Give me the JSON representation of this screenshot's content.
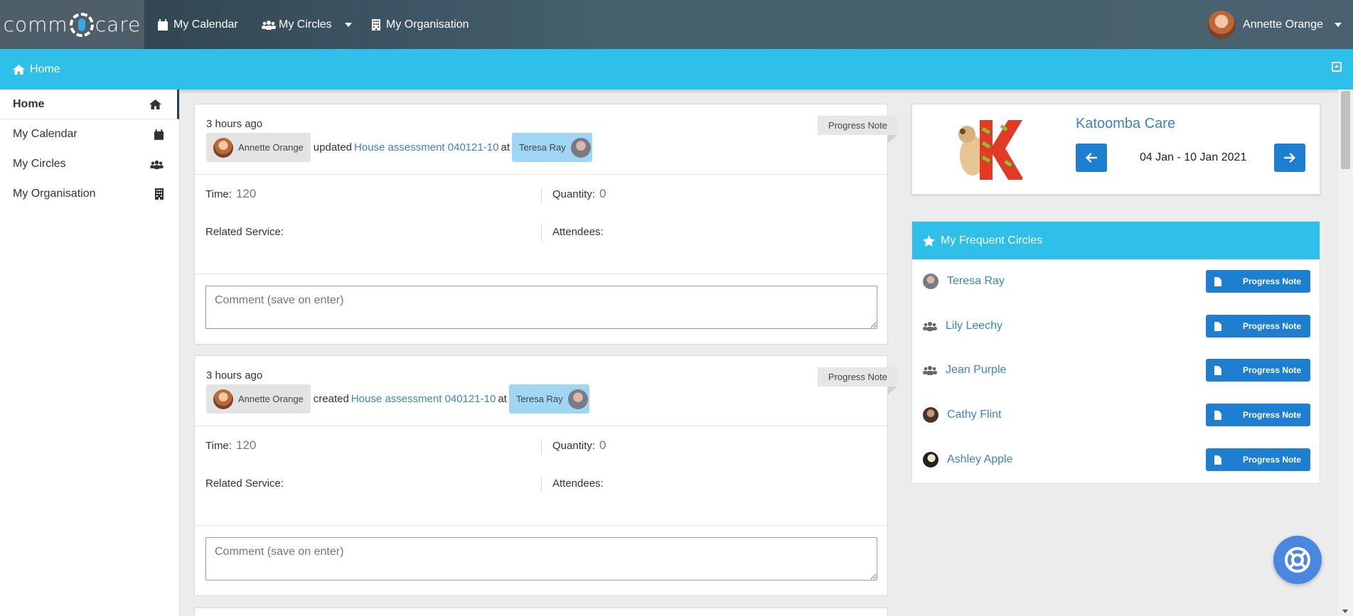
{
  "brand": {
    "left": "comm",
    "right": "care"
  },
  "nav": {
    "calendar": "My Calendar",
    "circles": "My Circles",
    "organisation": "My Organisation",
    "user": "Annette Orange"
  },
  "breadcrumb": {
    "home": "Home"
  },
  "sidebar": {
    "items": [
      {
        "label": "Home"
      },
      {
        "label": "My Calendar"
      },
      {
        "label": "My Circles"
      },
      {
        "label": "My Organisation"
      }
    ]
  },
  "feed": [
    {
      "time": "3 hours ago",
      "actor": "Annette Orange",
      "verb": "updated",
      "doc": "House assessment 040121-10",
      "at": "at",
      "client": "Teresa Ray",
      "tag": "Progress Note",
      "time_label": "Time:",
      "time_value": "120",
      "quantity_label": "Quantity:",
      "quantity_value": "0",
      "service_label": "Related Service:",
      "attendees_label": "Attendees:",
      "comment_placeholder": "Comment (save on enter)"
    },
    {
      "time": "3 hours ago",
      "actor": "Annette Orange",
      "verb": "created",
      "doc": "House assessment 040121-10",
      "at": "at",
      "client": "Teresa Ray",
      "tag": "Progress Note",
      "time_label": "Time:",
      "time_value": "120",
      "quantity_label": "Quantity:",
      "quantity_value": "0",
      "service_label": "Related Service:",
      "attendees_label": "Attendees:",
      "comment_placeholder": "Comment (save on enter)"
    }
  ],
  "care": {
    "logo_letter": "K",
    "name": "Katoomba Care",
    "range": "04 Jan - 10 Jan 2021"
  },
  "frequent": {
    "title": "My Frequent Circles",
    "button_label": "Progress Note",
    "items": [
      {
        "name": "Teresa Ray",
        "icon": "avatar"
      },
      {
        "name": "Lily Leechy",
        "icon": "group-icon"
      },
      {
        "name": "Jean Purple",
        "icon": "group-icon"
      },
      {
        "name": "Cathy Flint",
        "icon": "avatar"
      },
      {
        "name": "Ashley Apple",
        "icon": "avatar"
      }
    ]
  },
  "colors": {
    "accent": "#2ec0e8",
    "primary_button": "#1e7fd1",
    "link": "#3b83c2"
  }
}
